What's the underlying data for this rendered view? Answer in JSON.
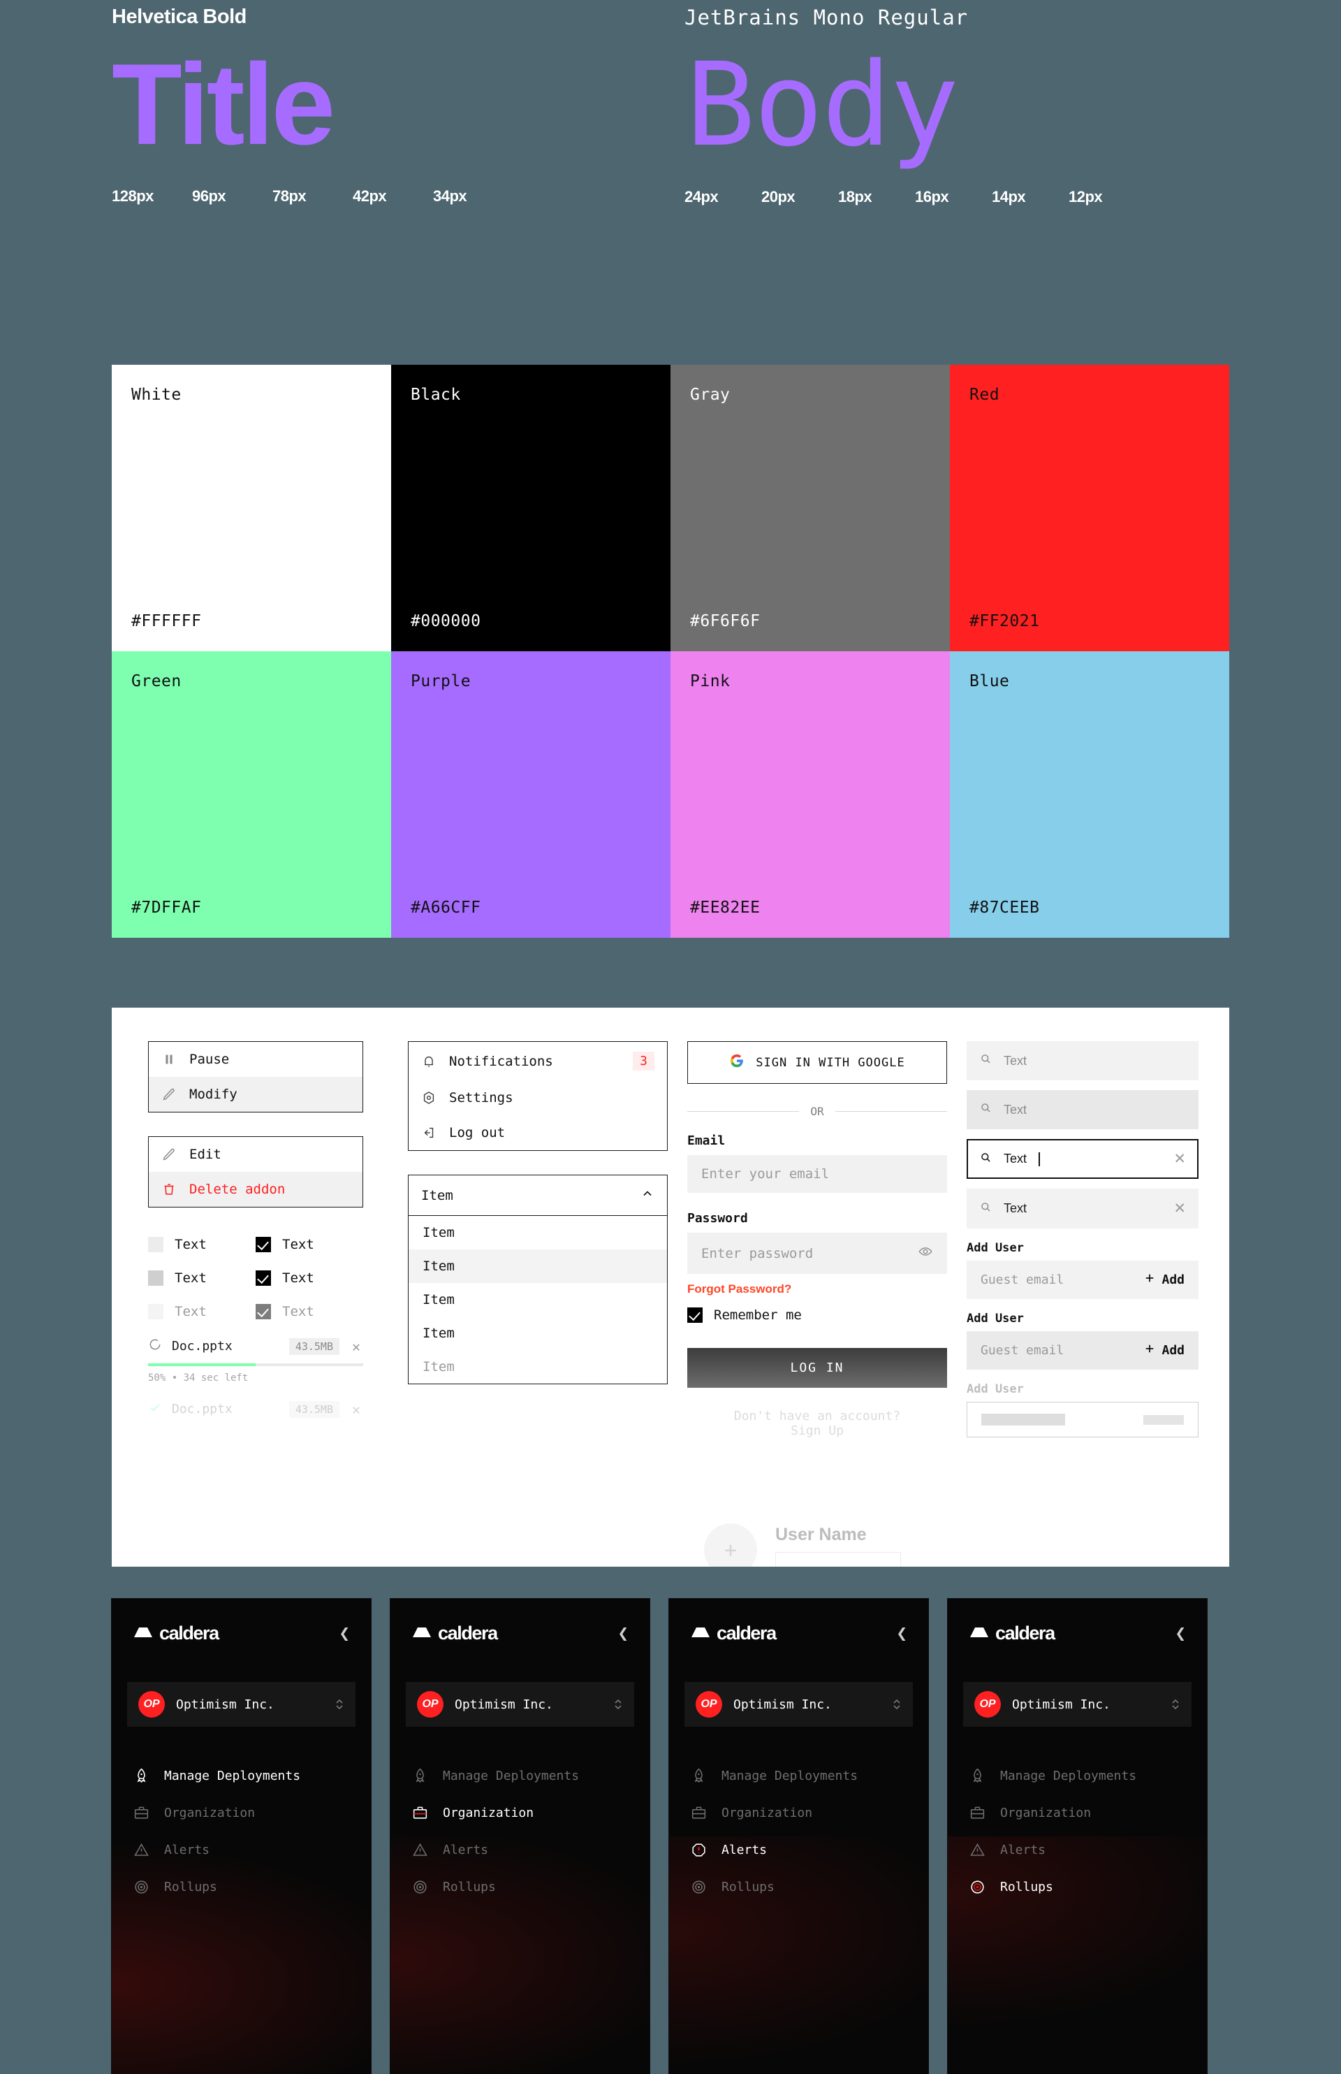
{
  "typography": {
    "title_font": {
      "name": "Helvetica Bold",
      "sample": "Title",
      "sizes": [
        "128px",
        "96px",
        "78px",
        "42px",
        "34px"
      ]
    },
    "body_font": {
      "name": "JetBrains Mono Regular",
      "sample": "Body",
      "sizes": [
        "24px",
        "20px",
        "18px",
        "16px",
        "14px",
        "12px"
      ]
    }
  },
  "palette": [
    {
      "name": "White",
      "hex": "#FFFFFF",
      "text": "#111111"
    },
    {
      "name": "Black",
      "hex": "#000000",
      "text": "#FFFFFF"
    },
    {
      "name": "Gray",
      "hex": "#6F6F6F",
      "text": "#FFFFFF"
    },
    {
      "name": "Red",
      "hex": "#FF2021",
      "text": "#111111"
    },
    {
      "name": "Green",
      "hex": "#7DFFAF",
      "text": "#111111"
    },
    {
      "name": "Purple",
      "hex": "#A66CFF",
      "text": "#111111"
    },
    {
      "name": "Pink",
      "hex": "#EE82EE",
      "text": "#111111"
    },
    {
      "name": "Blue",
      "hex": "#87CEEB",
      "text": "#111111"
    }
  ],
  "components": {
    "menu_primary": {
      "pause": "Pause",
      "modify": "Modify"
    },
    "menu_secondary": {
      "edit": "Edit",
      "delete": "Delete addon"
    },
    "menu_account": {
      "notifications": "Notifications",
      "notifications_count": "3",
      "settings": "Settings",
      "logout": "Log out"
    },
    "checkboxes": {
      "r1c1": "Text",
      "r1c2": "Text",
      "r2c1": "Text",
      "r2c2": "Text",
      "r3c1": "Text",
      "r3c2": "Text"
    },
    "upload": {
      "uploading_name": "Doc.pptx",
      "uploading_size": "43.5MB",
      "progress_pct": 50,
      "progress_note": "50% • 34 sec left",
      "done_name": "Doc.pptx",
      "done_size": "43.5MB"
    },
    "select": {
      "value": "Item",
      "options": [
        "Item",
        "Item",
        "Item",
        "Item",
        "Item"
      ]
    },
    "login": {
      "google_button": "SIGN IN WITH GOOGLE",
      "or": "OR",
      "email_label": "Email",
      "email_placeholder": "Enter your email",
      "password_label": "Password",
      "password_placeholder": "Enter password",
      "forgot": "Forgot Password?",
      "remember": "Remember me",
      "submit": "LOG IN",
      "signup_prompt": "Don't have an account?",
      "signup_link": "Sign Up"
    },
    "search": {
      "rest": "Text",
      "hover": "Text",
      "focus": "Text",
      "filled": "Text"
    },
    "add_user": {
      "label": "Add User",
      "placeholder": "Guest email",
      "add_button": "Add"
    },
    "user_card": {
      "name": "User Name"
    }
  },
  "nav_cards": [
    {
      "brand": "caldera",
      "org_initials": "OP",
      "org_name": "Optimism Inc.",
      "items": [
        {
          "label": "Manage Deployments",
          "icon": "rocket-icon",
          "active": true
        },
        {
          "label": "Organization",
          "icon": "briefcase-icon",
          "active": false
        },
        {
          "label": "Alerts",
          "icon": "warning-triangle-icon",
          "active": false
        },
        {
          "label": "Rollups",
          "icon": "target-icon",
          "active": false
        }
      ]
    },
    {
      "brand": "caldera",
      "org_initials": "OP",
      "org_name": "Optimism Inc.",
      "items": [
        {
          "label": "Manage Deployments",
          "icon": "rocket-icon",
          "active": false
        },
        {
          "label": "Organization",
          "icon": "briefcase-icon",
          "active": true
        },
        {
          "label": "Alerts",
          "icon": "warning-triangle-icon",
          "active": false
        },
        {
          "label": "Rollups",
          "icon": "target-icon",
          "active": false
        }
      ]
    },
    {
      "brand": "caldera",
      "org_initials": "OP",
      "org_name": "Optimism Inc.",
      "items": [
        {
          "label": "Manage Deployments",
          "icon": "rocket-icon",
          "active": false
        },
        {
          "label": "Organization",
          "icon": "briefcase-icon",
          "active": false
        },
        {
          "label": "Alerts",
          "icon": "warning-octagon-icon",
          "active": true
        },
        {
          "label": "Rollups",
          "icon": "target-icon",
          "active": false
        }
      ]
    },
    {
      "brand": "caldera",
      "org_initials": "OP",
      "org_name": "Optimism Inc.",
      "items": [
        {
          "label": "Manage Deployments",
          "icon": "rocket-icon",
          "active": false
        },
        {
          "label": "Organization",
          "icon": "briefcase-icon",
          "active": false
        },
        {
          "label": "Alerts",
          "icon": "warning-triangle-icon",
          "active": false
        },
        {
          "label": "Rollups",
          "icon": "target-icon",
          "active": true
        }
      ]
    }
  ]
}
